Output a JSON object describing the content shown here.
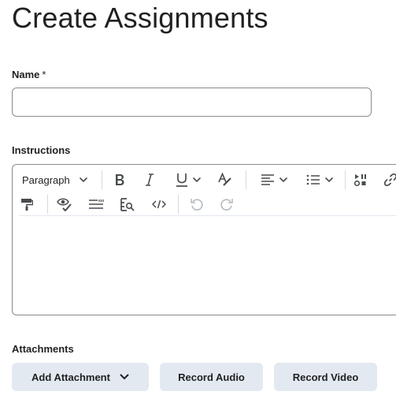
{
  "page": {
    "title": "Create Assignments"
  },
  "name_field": {
    "label": "Name",
    "required_mark": "*",
    "value": "",
    "placeholder": ""
  },
  "instructions": {
    "label": "Instructions",
    "toolbar": {
      "block_format": "Paragraph",
      "row1_icons": [
        "bold-icon",
        "italic-icon",
        "underline-icon",
        "chevron-down-icon",
        "text-color-icon",
        "align-left-icon",
        "chevron-down-icon",
        "bulleted-list-icon",
        "chevron-down-icon",
        "media-insert-icon",
        "link-icon"
      ],
      "row2_icons": [
        "format-painter-icon",
        "accessibility-check-icon",
        "word-count-icon",
        "find-replace-icon",
        "source-code-icon",
        "undo-icon",
        "redo-icon"
      ]
    },
    "content": ""
  },
  "attachments": {
    "label": "Attachments",
    "add_attachment_label": "Add Attachment",
    "record_audio_label": "Record Audio",
    "record_video_label": "Record Video"
  },
  "colors": {
    "button_bg": "#e3e9f1",
    "border": "#868c8f",
    "text": "#202122",
    "icon": "#494c4e"
  }
}
